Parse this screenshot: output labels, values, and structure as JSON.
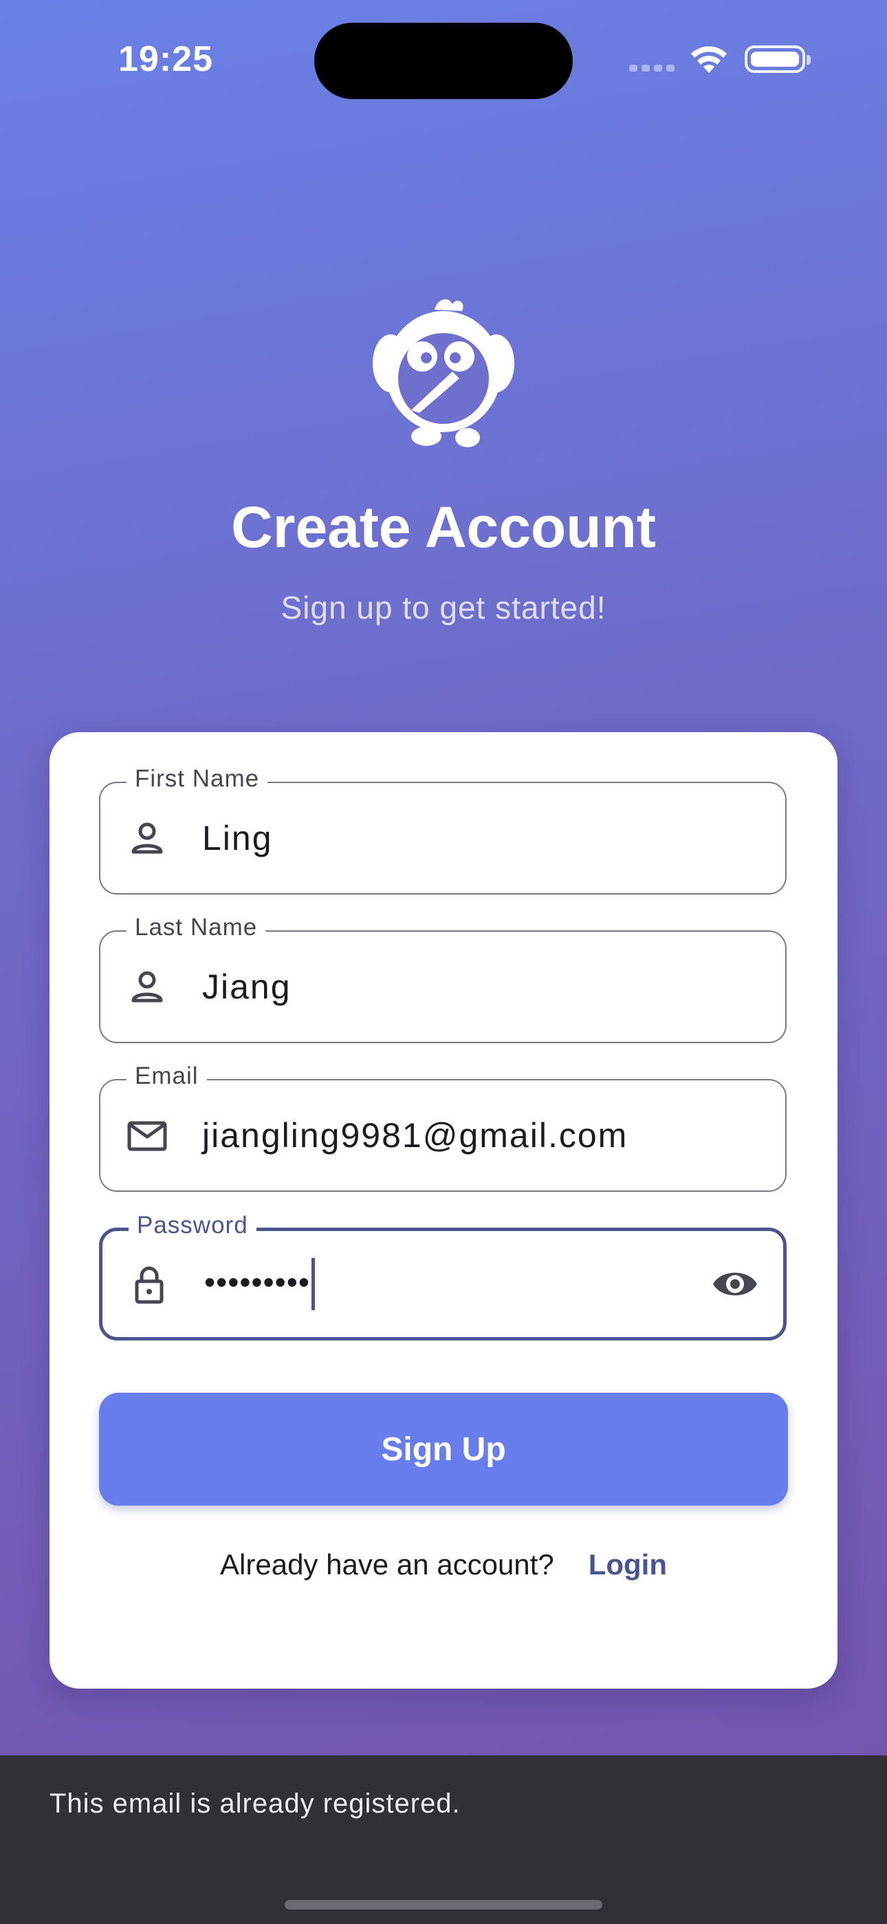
{
  "status_bar": {
    "time": "19:25"
  },
  "header": {
    "logo_icon": "bird-mascot-icon",
    "title": "Create Account",
    "subtitle": "Sign up to get started!"
  },
  "form": {
    "first_name": {
      "label": "First Name",
      "value": "Ling",
      "icon": "person-icon"
    },
    "last_name": {
      "label": "Last Name",
      "value": "Jiang",
      "icon": "person-icon"
    },
    "email": {
      "label": "Email",
      "value": "jiangling9981@gmail.com",
      "icon": "mail-icon"
    },
    "password": {
      "label": "Password",
      "value": "•••••••••",
      "icon": "lock-icon",
      "toggle_icon": "eye-icon"
    },
    "submit_label": "Sign Up"
  },
  "footer": {
    "prompt": "Already have an account?",
    "login_label": "Login"
  },
  "snackbar": {
    "message": "This email is already registered."
  },
  "colors": {
    "accent": "#677deb",
    "link": "#4a5590",
    "snackbar_bg": "#313036"
  }
}
